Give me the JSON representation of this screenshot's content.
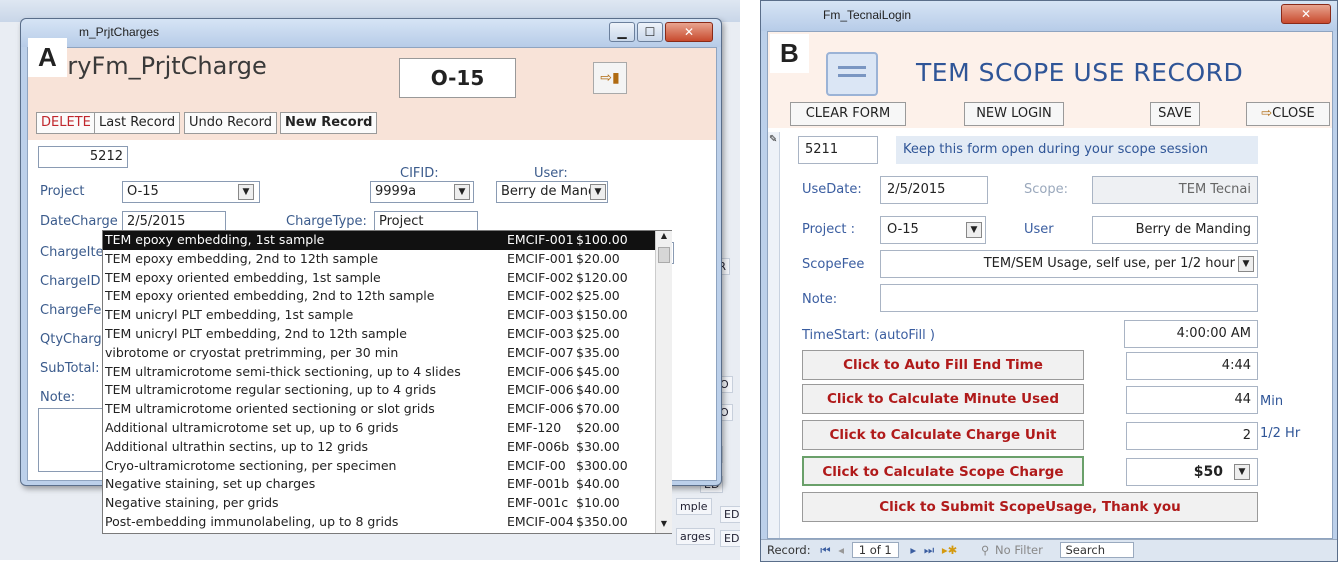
{
  "panel_a": {
    "letter": "A",
    "window_title": "m_PrjtCharges",
    "form_title": "tryFm_PrjtCharge",
    "toolbar": {
      "delete": "DELETE",
      "last_record": "Last Record",
      "undo_record": "Undo Record",
      "new_record": "New Record"
    },
    "project_code_display": "O-15",
    "record_id": "5212",
    "labels": {
      "project": "Project",
      "cifid": "CIFID:",
      "user": "User:",
      "date_charge": "DateCharge",
      "charge_type": "ChargeType:",
      "charge_item": "ChargeItem:",
      "charge_id": "ChargeID",
      "charge_fee": "ChargeFee",
      "qty_charge": "QtyCharge",
      "subtotal": "SubTotal:",
      "note": "Note:"
    },
    "values": {
      "project": "O-15",
      "cifid": "9999a",
      "user": "Berry de Mand",
      "date_charge": "2/5/2015",
      "charge_type": "Project",
      "charge_item": ""
    },
    "charge_items": [
      [
        "TEM epoxy embedding, 1st sample",
        "EMCIF-001",
        "$100.00"
      ],
      [
        "TEM epoxy embedding, 2nd to 12th sample",
        "EMCIF-001",
        "$20.00"
      ],
      [
        "TEM epoxy oriented embedding, 1st sample",
        "EMCIF-002",
        "$120.00"
      ],
      [
        "TEM epoxy oriented embedding, 2nd to 12th sample",
        "EMCIF-002",
        "$25.00"
      ],
      [
        "TEM unicryl PLT embedding, 1st sample",
        "EMCIF-003",
        "$150.00"
      ],
      [
        "TEM unicryl PLT embedding, 2nd to 12th sample",
        "EMCIF-003",
        "$25.00"
      ],
      [
        "vibrotome or cryostat pretrimming, per 30 min",
        "EMCIF-007",
        "$35.00"
      ],
      [
        "TEM ultramicrotome semi-thick sectioning, up to 4 slides",
        "EMCIF-006",
        "$45.00"
      ],
      [
        "TEM ultramicrotome regular sectioning, up to 4 grids",
        "EMCIF-006",
        "$40.00"
      ],
      [
        "TEM ultramicrotome oriented sectioning or slot grids",
        "EMCIF-006",
        "$70.00"
      ],
      [
        "Additional ultramicrotome set up,  up to 6 grids",
        "EMF-120",
        "$20.00"
      ],
      [
        "Additional ultrathin sectins, up to 12 grids",
        "EMF-006b",
        "$30.00"
      ],
      [
        "Cryo-ultramicrotome sectioning, per specimen",
        "EMCIF-00",
        "$300.00"
      ],
      [
        "Negative staining, set up charges",
        "EMF-001b",
        "$40.00"
      ],
      [
        "Negative staining, per grids",
        "EMF-001c",
        "$10.00"
      ],
      [
        "Post-embedding immunolabeling, up to 8 grids",
        "EMCIF-004",
        "$350.00"
      ]
    ],
    "background_text": [
      "ED",
      "ED",
      "ED",
      "ED",
      "O",
      "O",
      "mple",
      "arges",
      "FR"
    ]
  },
  "panel_b": {
    "letter": "B",
    "window_title": "Fm_TecnaiLogin",
    "title": "TEM SCOPE USE RECORD",
    "buttons": {
      "clear_form": "CLEAR FORM",
      "new_login": "NEW LOGIN",
      "save": "SAVE",
      "close": "CLOSE"
    },
    "record_id": "5211",
    "notice": "Keep  this form open during your scope session",
    "labels": {
      "use_date": "UseDate:",
      "scope": "Scope:",
      "project": "Project :",
      "user": "User",
      "scope_fee": "ScopeFee",
      "note": "Note:",
      "time_start": "TimeStart: (autoFill )"
    },
    "values": {
      "use_date": "2/5/2015",
      "scope": "TEM Tecnai",
      "project": "O-15",
      "user": "Berry de Manding",
      "scope_fee": "TEM/SEM Usage, self use, per 1/2 hour",
      "note": "",
      "time_start": "4:00:00 AM",
      "end_time": "4:44",
      "minutes": "44",
      "charge_unit": "2",
      "charge": "$50"
    },
    "actions": {
      "end_time": "Click to Auto Fill  End Time",
      "minutes": "Click  to Calculate Minute Used",
      "charge_unit": "Click  to Calculate Charge Unit",
      "charge": "Click to Calculate Scope Charge",
      "submit": "Click to Submit ScopeUsage, Thank you"
    },
    "units": {
      "minutes": "Min",
      "charge_unit": "1/2 Hr"
    },
    "record_nav": {
      "label": "Record:",
      "position": "1 of 1",
      "filter": "No Filter",
      "search": "Search"
    }
  }
}
